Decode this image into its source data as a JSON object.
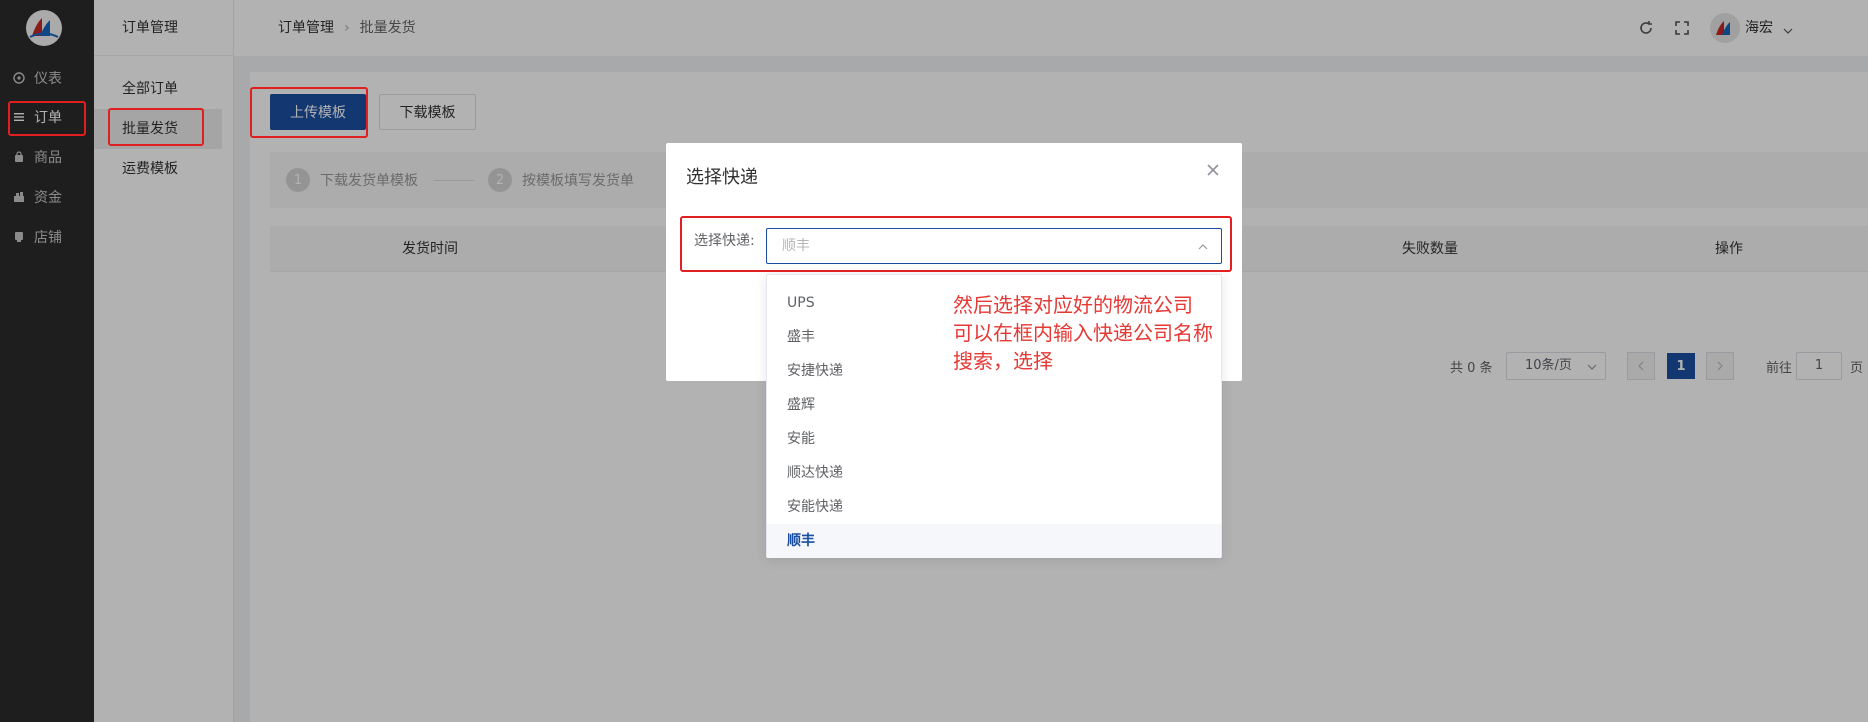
{
  "nav": {
    "items": [
      {
        "label": "仪表",
        "icon": "dashboard-icon"
      },
      {
        "label": "订单",
        "icon": "list-icon"
      },
      {
        "label": "商品",
        "icon": "bag-icon"
      },
      {
        "label": "资金",
        "icon": "money-icon"
      },
      {
        "label": "店铺",
        "icon": "shop-icon"
      }
    ]
  },
  "submenu": {
    "title": "订单管理",
    "items": [
      {
        "label": "全部订单"
      },
      {
        "label": "批量发货"
      },
      {
        "label": "运费模板"
      }
    ]
  },
  "header": {
    "breadcrumb": [
      "订单管理",
      "批量发货"
    ],
    "user_name": "海宏"
  },
  "toolbar": {
    "upload_label": "上传模板",
    "download_label": "下载模板"
  },
  "steps": [
    {
      "num": "1",
      "label": "下载发货单模板"
    },
    {
      "num": "2",
      "label": "按模板填写发货单"
    }
  ],
  "table": {
    "columns": [
      "发货时间",
      "失败数量",
      "操作"
    ]
  },
  "pager": {
    "total": "共 0 条",
    "page_size": "10条/页",
    "current": "1",
    "goto_label": "前往",
    "goto_value": "1",
    "page_unit": "页"
  },
  "dialog": {
    "title": "选择快递",
    "field_label": "选择快递:",
    "placeholder": "顺丰",
    "options": [
      "UPS",
      "盛丰",
      "安捷快递",
      "盛辉",
      "安能",
      "顺达快递",
      "安能快递",
      "顺丰"
    ],
    "selected": "顺丰"
  },
  "annotation": {
    "lines": [
      "然后选择对应好的物流公司",
      "可以在框内输入快递公司名称",
      "搜索，选择"
    ],
    "color": "#e53935"
  },
  "colors": {
    "primary": "#1a4fa3",
    "nav_bg": "#2b2b2b",
    "annotation_red": "#e02020"
  }
}
